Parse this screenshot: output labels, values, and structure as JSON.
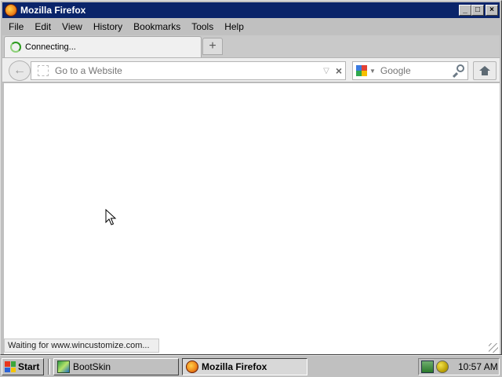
{
  "window": {
    "title": "Mozilla Firefox",
    "controls": {
      "minimize": "_",
      "maximize": "□",
      "close": "×"
    }
  },
  "menu": [
    "File",
    "Edit",
    "View",
    "History",
    "Bookmarks",
    "Tools",
    "Help"
  ],
  "tabs": [
    {
      "label": "Connecting...",
      "icon": "loading-spinner-icon"
    }
  ],
  "new_tab_label": "+",
  "navigation": {
    "url_placeholder": "Go to a Website",
    "url_value": "",
    "stop_glyph": "×",
    "dropdown_glyph": "▽",
    "search_placeholder": "Google",
    "search_engine_icon": "google-icon"
  },
  "status": "Waiting for www.wincustomize.com...",
  "taskbar": {
    "start_label": "Start",
    "tasks": [
      {
        "label": "BootSkin",
        "icon": "bootskin-icon",
        "active": false
      },
      {
        "label": "Mozilla Firefox",
        "icon": "firefox-icon",
        "active": true
      }
    ],
    "clock": "10:57 AM"
  },
  "colors": {
    "titlebar": "#0a246a",
    "chrome": "#c0c0c0",
    "content": "#ffffff"
  }
}
